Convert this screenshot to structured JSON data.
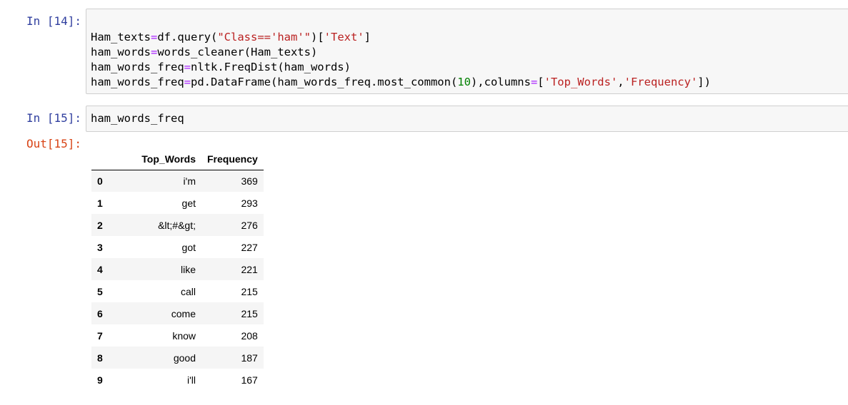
{
  "cells": [
    {
      "prompt": "In [14]:",
      "code_lines": [
        [
          [
            "plain",
            "Ham_texts"
          ],
          [
            "op",
            "="
          ],
          [
            "plain",
            "df.query("
          ],
          [
            "str",
            "\"Class=='ham'\""
          ],
          [
            "plain",
            ")["
          ],
          [
            "str",
            "'Text'"
          ],
          [
            "plain",
            "]"
          ]
        ],
        [
          [
            "plain",
            "ham_words"
          ],
          [
            "op",
            "="
          ],
          [
            "plain",
            "words_cleaner(Ham_texts)"
          ]
        ],
        [
          [
            "plain",
            "ham_words_freq"
          ],
          [
            "op",
            "="
          ],
          [
            "plain",
            "nltk.FreqDist(ham_words)"
          ]
        ],
        [
          [
            "plain",
            "ham_words_freq"
          ],
          [
            "op",
            "="
          ],
          [
            "plain",
            "pd.DataFrame(ham_words_freq.most_common("
          ],
          [
            "num",
            "10"
          ],
          [
            "plain",
            "),columns"
          ],
          [
            "op",
            "="
          ],
          [
            "plain",
            "["
          ],
          [
            "str",
            "'Top_Words'"
          ],
          [
            "plain",
            ","
          ],
          [
            "str",
            "'Frequency'"
          ],
          [
            "plain",
            "])"
          ]
        ]
      ]
    },
    {
      "prompt": "In [15]:",
      "code_lines": [
        [
          [
            "plain",
            "ham_words_freq"
          ]
        ]
      ],
      "out_prompt": "Out[15]:",
      "output_table": {
        "columns": [
          "",
          "Top_Words",
          "Frequency"
        ],
        "rows": [
          {
            "index": "0",
            "word": "i'm",
            "freq": "369"
          },
          {
            "index": "1",
            "word": "get",
            "freq": "293"
          },
          {
            "index": "2",
            "word": "&lt;#&gt;",
            "freq": "276"
          },
          {
            "index": "3",
            "word": "got",
            "freq": "227"
          },
          {
            "index": "4",
            "word": "like",
            "freq": "221"
          },
          {
            "index": "5",
            "word": "call",
            "freq": "215"
          },
          {
            "index": "6",
            "word": "come",
            "freq": "215"
          },
          {
            "index": "7",
            "word": "know",
            "freq": "208"
          },
          {
            "index": "8",
            "word": "good",
            "freq": "187"
          },
          {
            "index": "9",
            "word": "i'll",
            "freq": "167"
          }
        ]
      }
    }
  ],
  "colors": {
    "prompt_in": "#303F9F",
    "prompt_out": "#D84315",
    "input_bg": "#f7f7f7",
    "input_border": "#cfcfcf",
    "operator": "#AA22FF",
    "string": "#BA2121",
    "number": "#008000"
  }
}
